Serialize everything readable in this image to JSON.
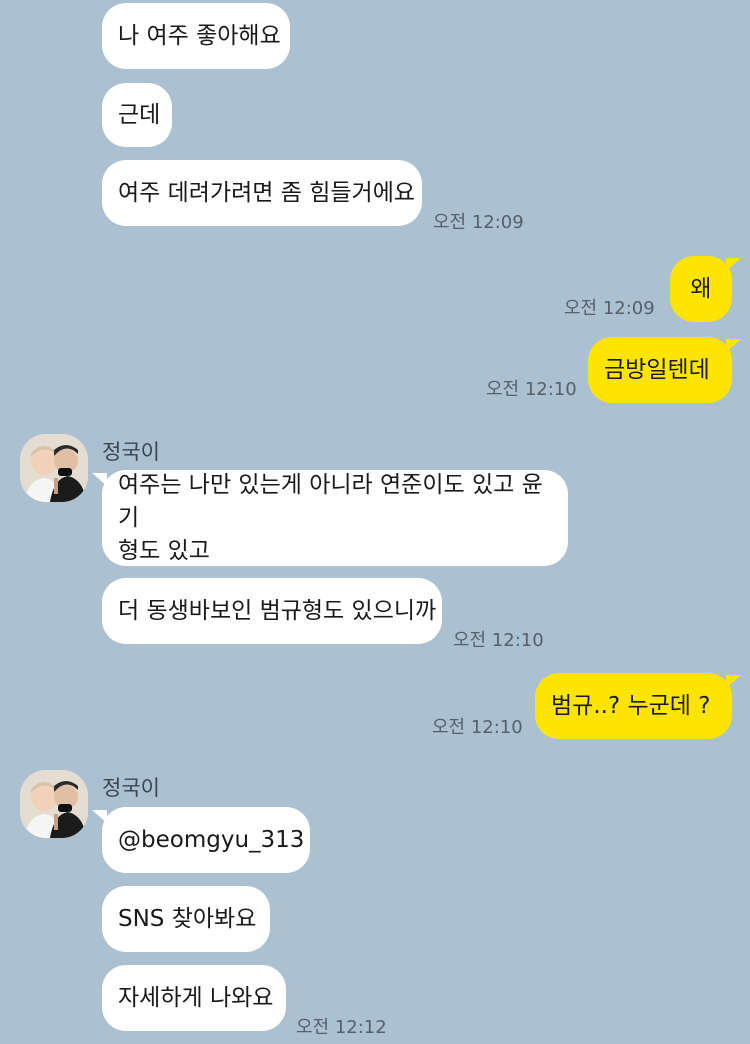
{
  "contact": {
    "name": "정국이"
  },
  "messages": [
    {
      "text": "나 여주 좋아해요"
    },
    {
      "text": "근데"
    },
    {
      "text": "여주 데려가려면 좀 힘들거에요",
      "time": "오전 12:09"
    },
    {
      "text": "왜",
      "time": "오전 12:09"
    },
    {
      "text": "금방일텐데",
      "time": "오전 12:10"
    },
    {
      "text": "여주는 나만 있는게 아니라 연준이도 있고 윤기\n형도 있고"
    },
    {
      "text": "더 동생바보인 범규형도 있으니까",
      "time": "오전 12:10"
    },
    {
      "text": "범규..? 누군데 ?",
      "time": "오전 12:10"
    },
    {
      "text": "@beomgyu_313"
    },
    {
      "text": "SNS 찾아봐요"
    },
    {
      "text": "자세하게 나와요",
      "time": "오전 12:12"
    }
  ],
  "colors": {
    "background": "#abc1d1",
    "incoming": "#ffffff",
    "outgoing": "#fee500"
  },
  "icons": {
    "avatar": "profile-photo"
  }
}
